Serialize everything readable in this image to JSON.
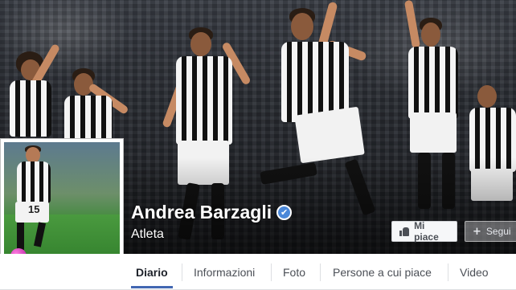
{
  "profile": {
    "name": "Andrea Barzagli",
    "category": "Atleta",
    "verified_badge": "✔",
    "jersey_number": "15"
  },
  "actions": {
    "like_label": "Mi piace",
    "follow_label": "Segui",
    "follow_icon": "+"
  },
  "tabs": [
    {
      "label": "Diario",
      "active": true
    },
    {
      "label": "Informazioni",
      "active": false
    },
    {
      "label": "Foto",
      "active": false
    },
    {
      "label": "Persone a cui piace",
      "active": false
    },
    {
      "label": "Video",
      "active": false
    }
  ],
  "colors": {
    "accent": "#4267b2",
    "verified": "#4b88d9",
    "tab_bar": "#ffffff"
  }
}
